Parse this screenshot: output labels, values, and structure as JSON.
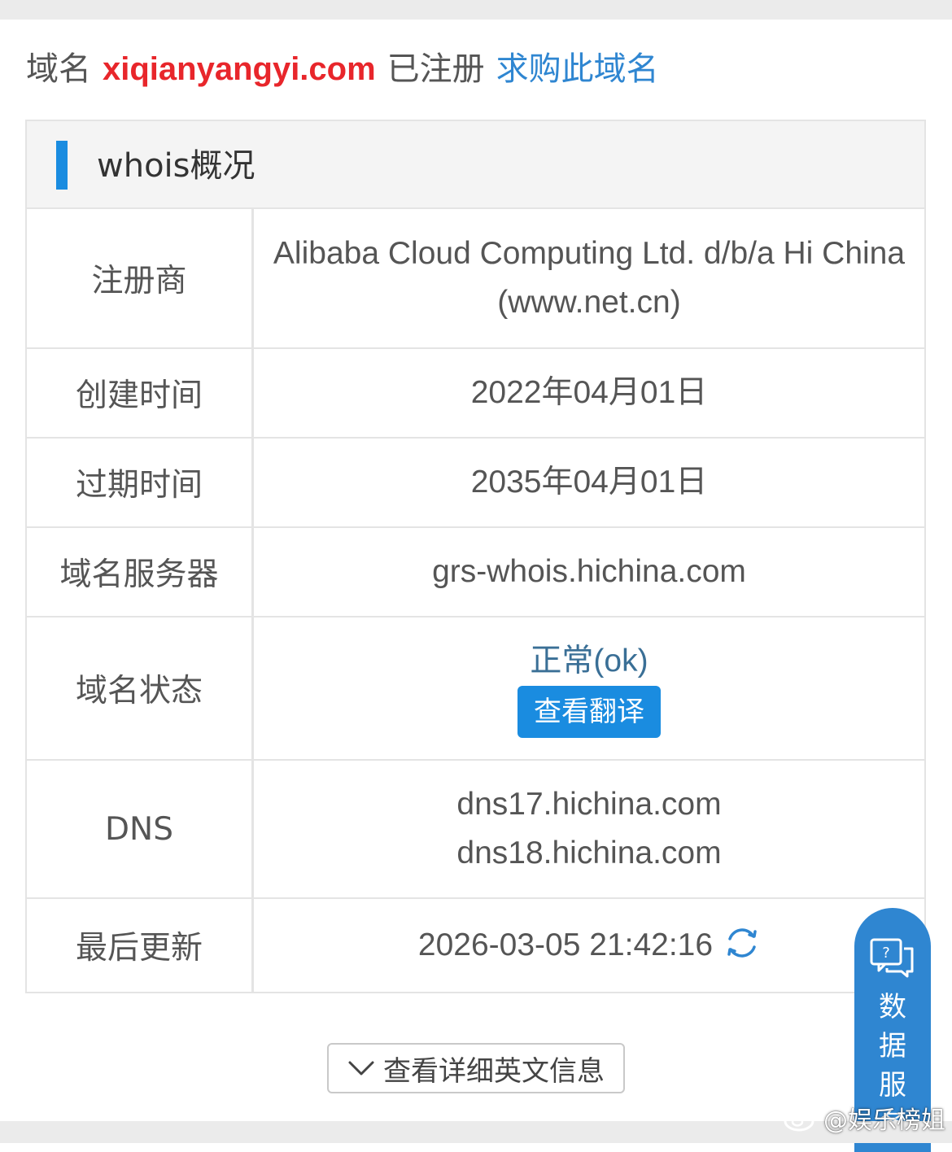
{
  "header": {
    "prefix": "域名",
    "domain": "xiqianyangyi.com",
    "status": "已注册",
    "buy_link": "求购此域名"
  },
  "section": {
    "title": "whois概况"
  },
  "rows": [
    {
      "label": "注册商",
      "value": "Alibaba Cloud Computing Ltd. d/b/a Hi China (www.net.cn)"
    },
    {
      "label": "创建时间",
      "value": "2022年04月01日"
    },
    {
      "label": "过期时间",
      "value": "2035年04月01日"
    },
    {
      "label": "域名服务器",
      "value": "grs-whois.hichina.com"
    },
    {
      "label": "域名状态",
      "value": "正常(ok)",
      "button": "查看翻译"
    },
    {
      "label": "DNS",
      "values": [
        "dns17.hichina.com",
        "dns18.hichina.com"
      ]
    },
    {
      "label": "最后更新",
      "value": "2026-03-05 21:42:16"
    }
  ],
  "more_button": "查看详细英文信息",
  "side_tab": {
    "label": "数据服务"
  },
  "watermark": "@娱乐榜姐",
  "icons": {
    "refresh": "refresh-icon",
    "chevron": "chevron-down-icon",
    "chat": "chat-help-icon",
    "weibo": "weibo-icon"
  },
  "colors": {
    "domain_red": "#e8262b",
    "link_blue": "#2f86d1",
    "accent_blue": "#1a8ce0",
    "status_text": "#3a6f96"
  }
}
